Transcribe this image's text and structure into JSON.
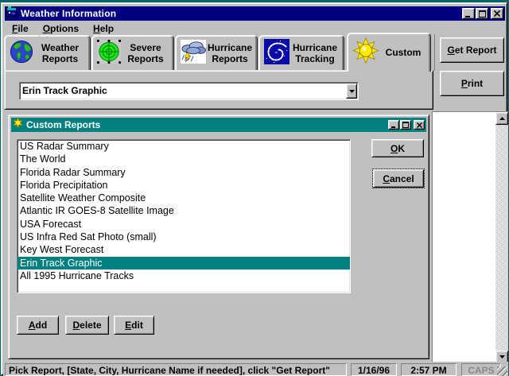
{
  "colors": {
    "window_bg": "#c0c0c0",
    "active_titlebar": "#000080",
    "dialog_titlebar": "#008080",
    "selection": "#008080",
    "selection_text": "#ffffff",
    "disabled_text": "#87898c"
  },
  "window": {
    "title": "Weather Information",
    "icon": "weather-app-icon",
    "controls": [
      "minimize-icon",
      "maximize-icon",
      "close-icon"
    ]
  },
  "menu": {
    "items": [
      {
        "pre": "",
        "accel": "F",
        "post": "ile"
      },
      {
        "pre": "",
        "accel": "O",
        "post": "ptions"
      },
      {
        "pre": "",
        "accel": "H",
        "post": "elp"
      }
    ]
  },
  "tabs": [
    {
      "lines": [
        "Weather",
        "Reports"
      ],
      "icon": "globe-icon",
      "selected": false
    },
    {
      "lines": [
        "Severe",
        "Reports"
      ],
      "icon": "radar-icon",
      "selected": false
    },
    {
      "lines": [
        "Hurricane",
        "Reports"
      ],
      "icon": "storm-icon",
      "selected": false
    },
    {
      "lines": [
        "Hurricane",
        "Tracking"
      ],
      "icon": "hurricane-icon",
      "selected": false
    },
    {
      "lines": [
        "Custom"
      ],
      "icon": "sun-icon",
      "selected": true
    }
  ],
  "actions": {
    "get_report": {
      "pre": "",
      "accel": "G",
      "post": "et Report"
    },
    "print": {
      "pre": "",
      "accel": "P",
      "post": "rint"
    }
  },
  "combobox": {
    "value": "Erin Track Graphic",
    "icon": "dropdown-arrow-icon"
  },
  "dialog": {
    "title": "Custom Reports",
    "icon": "small-sun-icon",
    "controls": [
      "minimize-icon",
      "maximize-icon",
      "close-icon"
    ],
    "list": [
      "US Radar Summary",
      "The World",
      "Florida Radar Summary",
      "Florida Precipitation",
      "Satellite Weather Composite",
      "Atlantic IR GOES-8 Satellite Image",
      "USA Forecast",
      "US Infra Red Sat Photo (small)",
      "Key West Forecast",
      "Erin Track Graphic",
      "All 1995 Hurricane Tracks"
    ],
    "selected_index": 9,
    "selected_item": "Erin Track Graphic",
    "buttons": {
      "ok": {
        "pre": "",
        "accel": "O",
        "post": "K"
      },
      "cancel": {
        "pre": "",
        "accel": "C",
        "post": "ancel"
      },
      "add": {
        "pre": "",
        "accel": "A",
        "post": "dd"
      },
      "delete": {
        "pre": "",
        "accel": "D",
        "post": "elete"
      },
      "edit": {
        "pre": "",
        "accel": "E",
        "post": "dit"
      }
    }
  },
  "statusbar": {
    "message": "Pick Report, [State, City, Hurricane Name if needed], click \"Get Report\"",
    "date": "1/16/96",
    "time": "2:57 PM",
    "caps": "CAPS"
  }
}
